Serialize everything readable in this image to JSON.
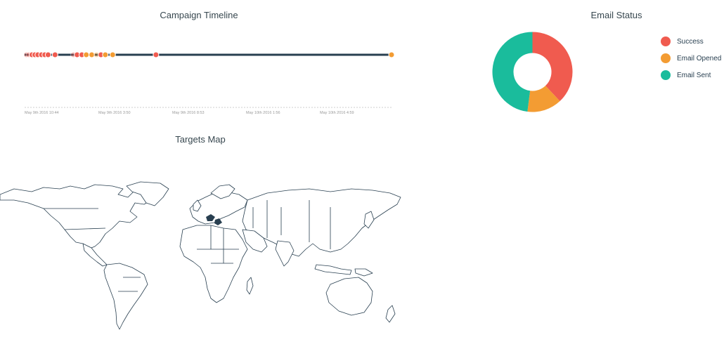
{
  "timeline": {
    "title": "Campaign Timeline",
    "tick_labels": [
      "May 9th 2016 10:44",
      "May 9th 2016 3:50",
      "May 9th 2016 8:53",
      "May 10th 2016 1:56",
      "May 10th 2016 4:59"
    ],
    "events": [
      {
        "pos": 0.005,
        "status": "success",
        "faded": true
      },
      {
        "pos": 0.012,
        "status": "success",
        "faded": true
      },
      {
        "pos": 0.02,
        "status": "success",
        "faded": false
      },
      {
        "pos": 0.028,
        "status": "success",
        "faded": false
      },
      {
        "pos": 0.036,
        "status": "success",
        "faded": false
      },
      {
        "pos": 0.046,
        "status": "success",
        "faded": false
      },
      {
        "pos": 0.055,
        "status": "success",
        "faded": false
      },
      {
        "pos": 0.064,
        "status": "success",
        "faded": false
      },
      {
        "pos": 0.083,
        "status": "success",
        "faded": false
      },
      {
        "pos": 0.133,
        "status": "success",
        "faded": true
      },
      {
        "pos": 0.143,
        "status": "success",
        "faded": false
      },
      {
        "pos": 0.156,
        "status": "success",
        "faded": false
      },
      {
        "pos": 0.168,
        "status": "opened",
        "faded": false
      },
      {
        "pos": 0.183,
        "status": "opened",
        "faded": false
      },
      {
        "pos": 0.196,
        "status": "opened",
        "faded": true
      },
      {
        "pos": 0.208,
        "status": "success",
        "faded": false
      },
      {
        "pos": 0.22,
        "status": "opened",
        "faded": false
      },
      {
        "pos": 0.24,
        "status": "opened",
        "faded": false
      },
      {
        "pos": 0.358,
        "status": "success",
        "faded": false
      },
      {
        "pos": 1.0,
        "status": "opened",
        "faded": false
      }
    ]
  },
  "email_status": {
    "title": "Email Status",
    "legend": [
      {
        "label": "Success",
        "key": "success"
      },
      {
        "label": "Email Opened",
        "key": "opened"
      },
      {
        "label": "Email Sent",
        "key": "sent"
      }
    ],
    "slices": [
      {
        "key": "success",
        "value": 38
      },
      {
        "key": "opened",
        "value": 14
      },
      {
        "key": "sent",
        "value": 48
      }
    ]
  },
  "map": {
    "title": "Targets Map"
  },
  "colors": {
    "success": "#f05b4f",
    "opened": "#f39c33",
    "sent": "#1abc9c",
    "line": "#283f50"
  }
}
